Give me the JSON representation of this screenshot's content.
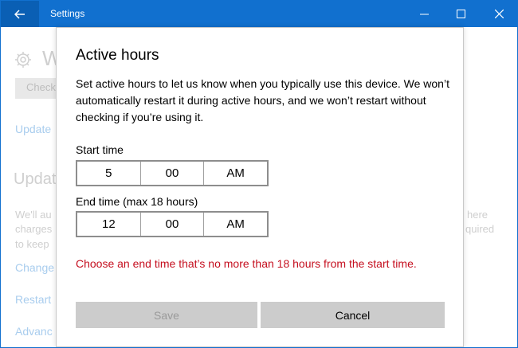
{
  "window": {
    "title": "Settings"
  },
  "background_page": {
    "heading_partial": "W",
    "check_button_partial": "Check",
    "update_link_partial": "Update",
    "section_heading_partial": "Updat",
    "para_line1_partial": "We'll au",
    "para_line2_partial": "charges",
    "para_line3_partial": "to keep",
    "right_line1_partial": "here",
    "right_line2_partial": "quired",
    "link_change_partial": "Change",
    "link_restart_partial": "Restart",
    "link_advanced_partial": "Advanc"
  },
  "dialog": {
    "title": "Active hours",
    "description": "Set active hours to let us know when you typically use this device. We won’t automatically restart it during active hours, and we won’t restart without checking if you’re using it.",
    "start_time": {
      "label": "Start time",
      "hour": "5",
      "minute": "00",
      "period": "AM"
    },
    "end_time": {
      "label": "End time (max 18 hours)",
      "hour": "12",
      "minute": "00",
      "period": "AM"
    },
    "error_message": "Choose an end time that’s no more than 18 hours from the start time.",
    "save_label": "Save",
    "cancel_label": "Cancel"
  },
  "colors": {
    "accent": "#1170cf",
    "error": "#c50f1f",
    "button_bg": "#cccccc"
  },
  "icons": {
    "back": "back-arrow-icon",
    "minimize": "minimize-icon",
    "maximize": "maximize-icon",
    "close": "close-icon",
    "gear": "gear-icon"
  }
}
